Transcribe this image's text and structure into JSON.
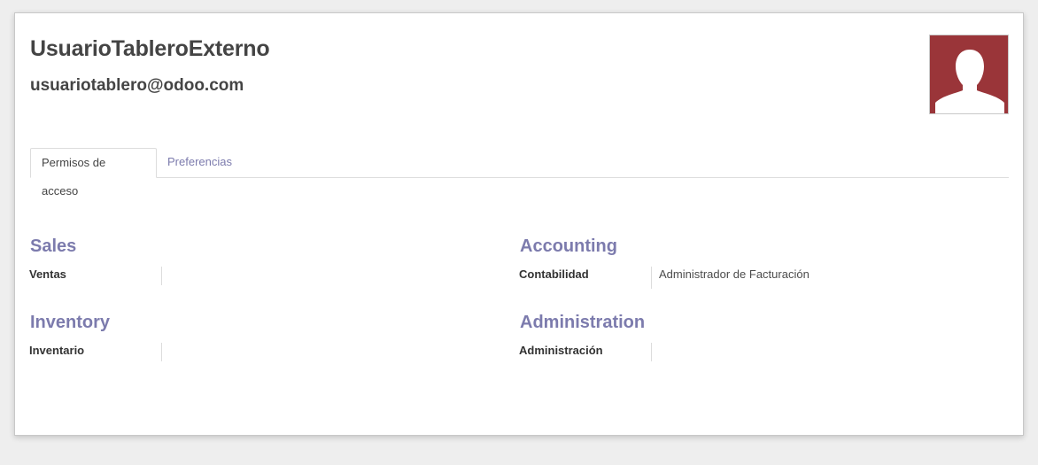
{
  "user": {
    "name": "UsuarioTableroExterno",
    "email": "usuariotablero@odoo.com",
    "avatar_color": "#9a3539"
  },
  "tabs": [
    {
      "label": "Permisos de acceso",
      "active": true
    },
    {
      "label": "Preferencias",
      "active": false
    }
  ],
  "groups": [
    {
      "title": "Sales",
      "field_label": "Ventas",
      "value": ""
    },
    {
      "title": "Accounting",
      "field_label": "Contabilidad",
      "value": "Administrador de Facturación"
    },
    {
      "title": "Inventory",
      "field_label": "Inventario",
      "value": ""
    },
    {
      "title": "Administration",
      "field_label": "Administración",
      "value": ""
    }
  ],
  "colors": {
    "accent": "#7c7bad",
    "text": "#4c4c4c"
  }
}
